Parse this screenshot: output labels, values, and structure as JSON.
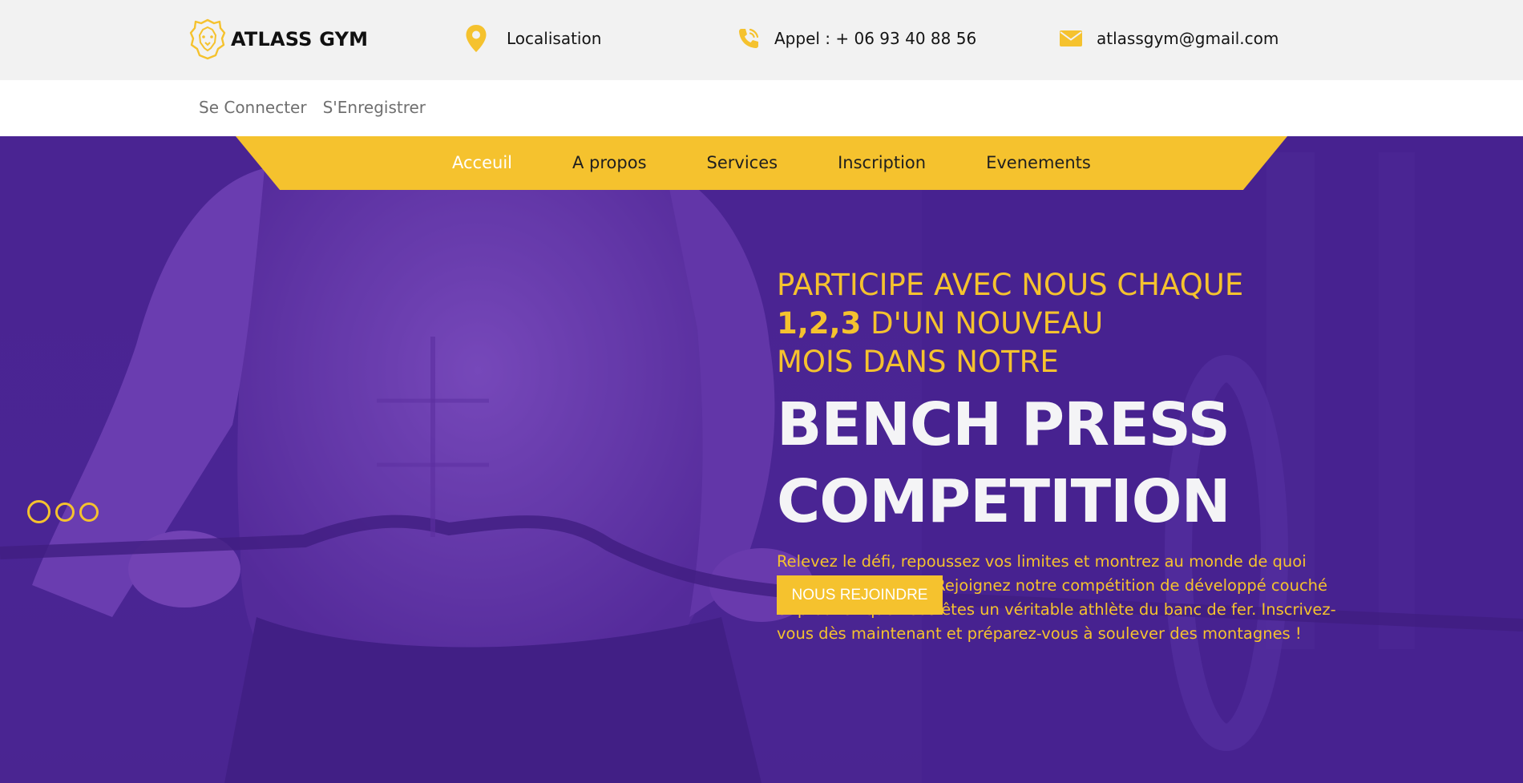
{
  "brand": {
    "name": "ATLASS GYM",
    "logo_icon": "lion-head-icon"
  },
  "contact": {
    "location": {
      "icon": "map-pin-icon",
      "label": "Localisation"
    },
    "phone": {
      "icon": "phone-icon",
      "label": "Appel : + 06 93 40 88 56"
    },
    "email": {
      "icon": "envelope-icon",
      "label": "atlassgym@gmail.com"
    }
  },
  "auth": {
    "login": "Se Connecter",
    "register": "S'Enregistrer"
  },
  "nav": {
    "items": [
      {
        "label": "Acceuil",
        "active": true
      },
      {
        "label": "A propos"
      },
      {
        "label": "Services"
      },
      {
        "label": "Inscription"
      },
      {
        "label": "Evenements"
      }
    ]
  },
  "hero": {
    "tagline_line1": "PARTICIPE AVEC NOUS CHAQUE",
    "tagline_highlight": "1,2,3",
    "tagline_line2_rest": " D'UN NOUVEAU",
    "tagline_line3": "MOIS DANS NOTRE",
    "headline_line1": "BENCH PRESS",
    "headline_line2": "COMPETITION",
    "description": "Relevez le défi, repoussez vos limites et montrez au monde de quoi vous êtes capable ! Rejoignez notre compétition de développé couché et prouvez que vous êtes un véritable athlète du banc de fer. Inscrivez-vous dès maintenant et préparez-vous à soulever des montagnes !",
    "cta": "NOUS REJOINDRE",
    "slide_count": 3,
    "active_slide": 1
  },
  "colors": {
    "accent": "#f5c22e",
    "hero_overlay": "#4a2492",
    "topbar_bg": "#f2f2f2",
    "headline": "#f4f4f6"
  }
}
